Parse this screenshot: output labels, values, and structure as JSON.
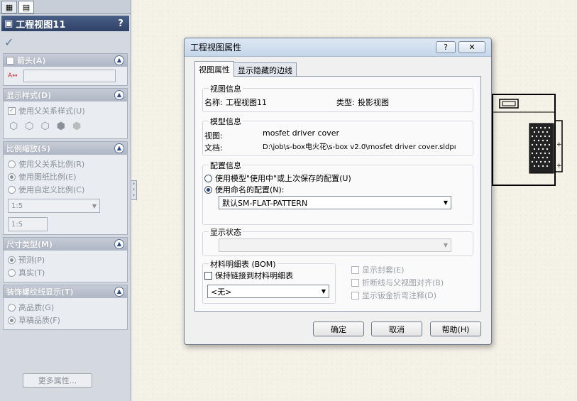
{
  "panel": {
    "tab_icons": [
      "tree-icon",
      "properties-icon"
    ],
    "title": "工程视图11",
    "help": "?",
    "ok_check": "✓",
    "arrow": {
      "title": "箭头(A)"
    },
    "display_style": {
      "title": "显示样式(D)",
      "use_parent": "使用父关系样式(U)"
    },
    "scale": {
      "title": "比例缩放(S)",
      "opt_parent": "使用父关系比例(R)",
      "opt_sheet": "使用图纸比例(E)",
      "opt_custom": "使用自定义比例(C)",
      "select_value": "1:5",
      "input_value": "1:5"
    },
    "dim_type": {
      "title": "尺寸类型(M)",
      "opt_projected": "预测(P)",
      "opt_true": "真实(T)"
    },
    "thread": {
      "title": "装饰螺纹线显示(T)",
      "opt_high": "高品质(G)",
      "opt_draft": "草稿品质(F)"
    },
    "more_button": "更多属性..."
  },
  "dialog": {
    "title": "工程视图属性",
    "help_btn": "?",
    "close_btn": "✕",
    "tabs": [
      "视图属性",
      "显示隐藏的边线"
    ],
    "view_info": {
      "legend": "视图信息",
      "name_label": "名称:",
      "name_value": "工程视图11",
      "type_label": "类型:",
      "type_value": "投影视图"
    },
    "model_info": {
      "legend": "模型信息",
      "view_label": "视图:",
      "view_value": "mosfet driver cover",
      "doc_label": "文档:",
      "doc_value": "D:\\job\\s-box电火花\\s-box v2.0\\mosfet driver cover.sldpı"
    },
    "config": {
      "legend": "配置信息",
      "opt_in_use": "使用模型\"使用中\"或上次保存的配置(U)",
      "opt_named": "使用命名的配置(N):",
      "selected": "默认SM-FLAT-PATTERN"
    },
    "display_state": {
      "legend": "显示状态",
      "value": ""
    },
    "bom": {
      "legend": "材料明细表 (BOM)",
      "keep_link": "保持链接到材料明细表",
      "selected": "<无>"
    },
    "options": {
      "envelope": "显示封套(E)",
      "align_parent": "折断线与父视图对齐(B)",
      "sheetmetal_notes": "显示钣金折弯注释(D)"
    },
    "buttons": {
      "ok": "确定",
      "cancel": "取消",
      "help": "帮助(H)"
    }
  }
}
